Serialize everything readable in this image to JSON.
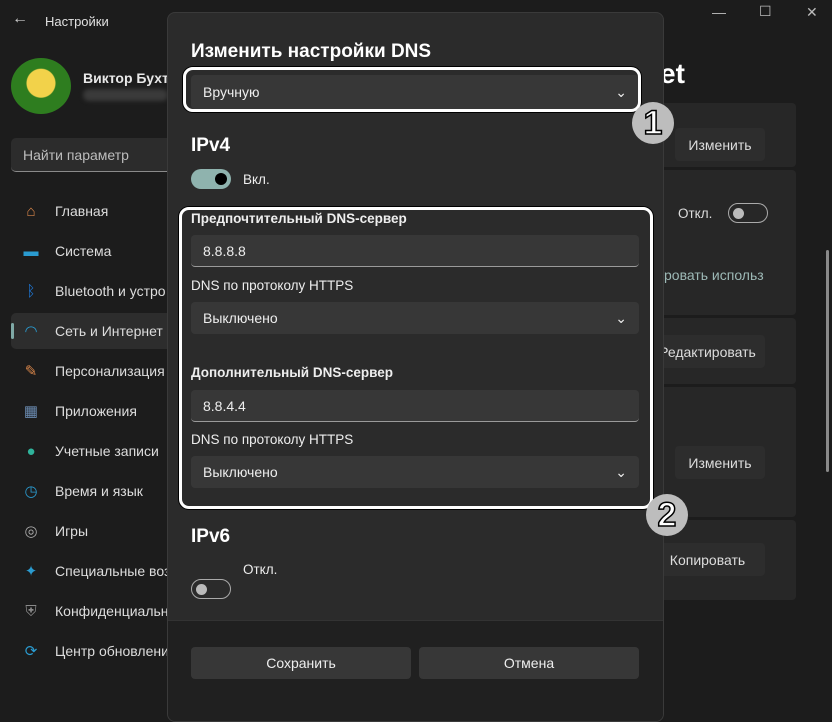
{
  "window": {
    "title": "Настройки"
  },
  "user": {
    "name": "Виктор Бухте"
  },
  "search": {
    "placeholder": "Найти параметр"
  },
  "sidebar": {
    "items": [
      {
        "label": "Главная",
        "icon": "home-icon",
        "color": "#d9864a"
      },
      {
        "label": "Система",
        "icon": "system-icon",
        "color": "#2a9bd0"
      },
      {
        "label": "Bluetooth и устро",
        "icon": "bluetooth-icon",
        "color": "#1e78d8"
      },
      {
        "label": "Сеть и Интернет",
        "icon": "wifi-icon",
        "color": "#2a9bd0"
      },
      {
        "label": "Персонализация",
        "icon": "brush-icon",
        "color": "#d9864a"
      },
      {
        "label": "Приложения",
        "icon": "apps-icon",
        "color": "#6a8ab0"
      },
      {
        "label": "Учетные записи",
        "icon": "accounts-icon",
        "color": "#2fb39b"
      },
      {
        "label": "Время и язык",
        "icon": "time-language-icon",
        "color": "#2a9bd0"
      },
      {
        "label": "Игры",
        "icon": "gaming-icon",
        "color": "#aaaaaa"
      },
      {
        "label": "Специальные воз",
        "icon": "accessibility-icon",
        "color": "#2a9bd0"
      },
      {
        "label": "Конфиденциальн",
        "icon": "shield-icon",
        "color": "#8a8a8a"
      },
      {
        "label": "Центр обновлени",
        "icon": "update-icon",
        "color": "#2a9bd0"
      }
    ]
  },
  "background": {
    "title_fragment": "et",
    "edit1": "Изменить",
    "toggle_label": "Откл.",
    "link_fragment": "ровать использ",
    "edit2": "Редактировать",
    "edit3": "Изменить",
    "copy": "Копировать"
  },
  "dialog": {
    "title": "Изменить настройки DNS",
    "mode": "Вручную",
    "ipv4": {
      "heading": "IPv4",
      "toggle_label": "Вкл.",
      "toggle_on": true,
      "preferred_label": "Предпочтительный DNS-сервер",
      "preferred_value": "8.8.8.8",
      "https_label_1": "DNS по протоколу HTTPS",
      "https_value_1": "Выключено",
      "alternate_label": "Дополнительный DNS-сервер",
      "alternate_value": "8.8.4.4",
      "https_label_2": "DNS по протоколу HTTPS",
      "https_value_2": "Выключено"
    },
    "ipv6": {
      "heading": "IPv6",
      "toggle_label": "Откл.",
      "toggle_on": false
    },
    "save": "Сохранить",
    "cancel": "Отмена"
  },
  "annotations": {
    "one": "1",
    "two": "2"
  }
}
